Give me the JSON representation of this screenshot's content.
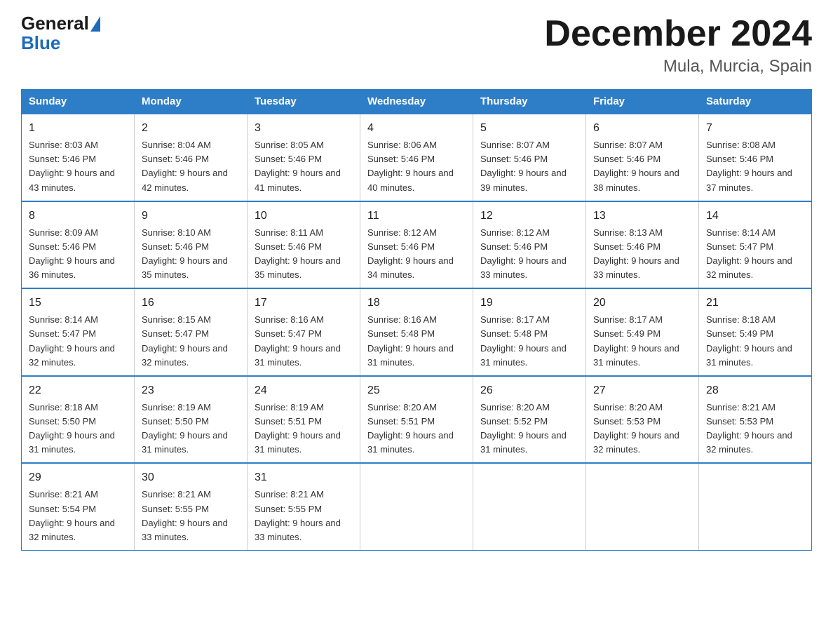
{
  "header": {
    "logo_general": "General",
    "logo_blue": "Blue",
    "title": "December 2024",
    "subtitle": "Mula, Murcia, Spain"
  },
  "days_of_week": [
    "Sunday",
    "Monday",
    "Tuesday",
    "Wednesday",
    "Thursday",
    "Friday",
    "Saturday"
  ],
  "weeks": [
    [
      {
        "day": "1",
        "sunrise": "Sunrise: 8:03 AM",
        "sunset": "Sunset: 5:46 PM",
        "daylight": "Daylight: 9 hours and 43 minutes."
      },
      {
        "day": "2",
        "sunrise": "Sunrise: 8:04 AM",
        "sunset": "Sunset: 5:46 PM",
        "daylight": "Daylight: 9 hours and 42 minutes."
      },
      {
        "day": "3",
        "sunrise": "Sunrise: 8:05 AM",
        "sunset": "Sunset: 5:46 PM",
        "daylight": "Daylight: 9 hours and 41 minutes."
      },
      {
        "day": "4",
        "sunrise": "Sunrise: 8:06 AM",
        "sunset": "Sunset: 5:46 PM",
        "daylight": "Daylight: 9 hours and 40 minutes."
      },
      {
        "day": "5",
        "sunrise": "Sunrise: 8:07 AM",
        "sunset": "Sunset: 5:46 PM",
        "daylight": "Daylight: 9 hours and 39 minutes."
      },
      {
        "day": "6",
        "sunrise": "Sunrise: 8:07 AM",
        "sunset": "Sunset: 5:46 PM",
        "daylight": "Daylight: 9 hours and 38 minutes."
      },
      {
        "day": "7",
        "sunrise": "Sunrise: 8:08 AM",
        "sunset": "Sunset: 5:46 PM",
        "daylight": "Daylight: 9 hours and 37 minutes."
      }
    ],
    [
      {
        "day": "8",
        "sunrise": "Sunrise: 8:09 AM",
        "sunset": "Sunset: 5:46 PM",
        "daylight": "Daylight: 9 hours and 36 minutes."
      },
      {
        "day": "9",
        "sunrise": "Sunrise: 8:10 AM",
        "sunset": "Sunset: 5:46 PM",
        "daylight": "Daylight: 9 hours and 35 minutes."
      },
      {
        "day": "10",
        "sunrise": "Sunrise: 8:11 AM",
        "sunset": "Sunset: 5:46 PM",
        "daylight": "Daylight: 9 hours and 35 minutes."
      },
      {
        "day": "11",
        "sunrise": "Sunrise: 8:12 AM",
        "sunset": "Sunset: 5:46 PM",
        "daylight": "Daylight: 9 hours and 34 minutes."
      },
      {
        "day": "12",
        "sunrise": "Sunrise: 8:12 AM",
        "sunset": "Sunset: 5:46 PM",
        "daylight": "Daylight: 9 hours and 33 minutes."
      },
      {
        "day": "13",
        "sunrise": "Sunrise: 8:13 AM",
        "sunset": "Sunset: 5:46 PM",
        "daylight": "Daylight: 9 hours and 33 minutes."
      },
      {
        "day": "14",
        "sunrise": "Sunrise: 8:14 AM",
        "sunset": "Sunset: 5:47 PM",
        "daylight": "Daylight: 9 hours and 32 minutes."
      }
    ],
    [
      {
        "day": "15",
        "sunrise": "Sunrise: 8:14 AM",
        "sunset": "Sunset: 5:47 PM",
        "daylight": "Daylight: 9 hours and 32 minutes."
      },
      {
        "day": "16",
        "sunrise": "Sunrise: 8:15 AM",
        "sunset": "Sunset: 5:47 PM",
        "daylight": "Daylight: 9 hours and 32 minutes."
      },
      {
        "day": "17",
        "sunrise": "Sunrise: 8:16 AM",
        "sunset": "Sunset: 5:47 PM",
        "daylight": "Daylight: 9 hours and 31 minutes."
      },
      {
        "day": "18",
        "sunrise": "Sunrise: 8:16 AM",
        "sunset": "Sunset: 5:48 PM",
        "daylight": "Daylight: 9 hours and 31 minutes."
      },
      {
        "day": "19",
        "sunrise": "Sunrise: 8:17 AM",
        "sunset": "Sunset: 5:48 PM",
        "daylight": "Daylight: 9 hours and 31 minutes."
      },
      {
        "day": "20",
        "sunrise": "Sunrise: 8:17 AM",
        "sunset": "Sunset: 5:49 PM",
        "daylight": "Daylight: 9 hours and 31 minutes."
      },
      {
        "day": "21",
        "sunrise": "Sunrise: 8:18 AM",
        "sunset": "Sunset: 5:49 PM",
        "daylight": "Daylight: 9 hours and 31 minutes."
      }
    ],
    [
      {
        "day": "22",
        "sunrise": "Sunrise: 8:18 AM",
        "sunset": "Sunset: 5:50 PM",
        "daylight": "Daylight: 9 hours and 31 minutes."
      },
      {
        "day": "23",
        "sunrise": "Sunrise: 8:19 AM",
        "sunset": "Sunset: 5:50 PM",
        "daylight": "Daylight: 9 hours and 31 minutes."
      },
      {
        "day": "24",
        "sunrise": "Sunrise: 8:19 AM",
        "sunset": "Sunset: 5:51 PM",
        "daylight": "Daylight: 9 hours and 31 minutes."
      },
      {
        "day": "25",
        "sunrise": "Sunrise: 8:20 AM",
        "sunset": "Sunset: 5:51 PM",
        "daylight": "Daylight: 9 hours and 31 minutes."
      },
      {
        "day": "26",
        "sunrise": "Sunrise: 8:20 AM",
        "sunset": "Sunset: 5:52 PM",
        "daylight": "Daylight: 9 hours and 31 minutes."
      },
      {
        "day": "27",
        "sunrise": "Sunrise: 8:20 AM",
        "sunset": "Sunset: 5:53 PM",
        "daylight": "Daylight: 9 hours and 32 minutes."
      },
      {
        "day": "28",
        "sunrise": "Sunrise: 8:21 AM",
        "sunset": "Sunset: 5:53 PM",
        "daylight": "Daylight: 9 hours and 32 minutes."
      }
    ],
    [
      {
        "day": "29",
        "sunrise": "Sunrise: 8:21 AM",
        "sunset": "Sunset: 5:54 PM",
        "daylight": "Daylight: 9 hours and 32 minutes."
      },
      {
        "day": "30",
        "sunrise": "Sunrise: 8:21 AM",
        "sunset": "Sunset: 5:55 PM",
        "daylight": "Daylight: 9 hours and 33 minutes."
      },
      {
        "day": "31",
        "sunrise": "Sunrise: 8:21 AM",
        "sunset": "Sunset: 5:55 PM",
        "daylight": "Daylight: 9 hours and 33 minutes."
      },
      null,
      null,
      null,
      null
    ]
  ]
}
